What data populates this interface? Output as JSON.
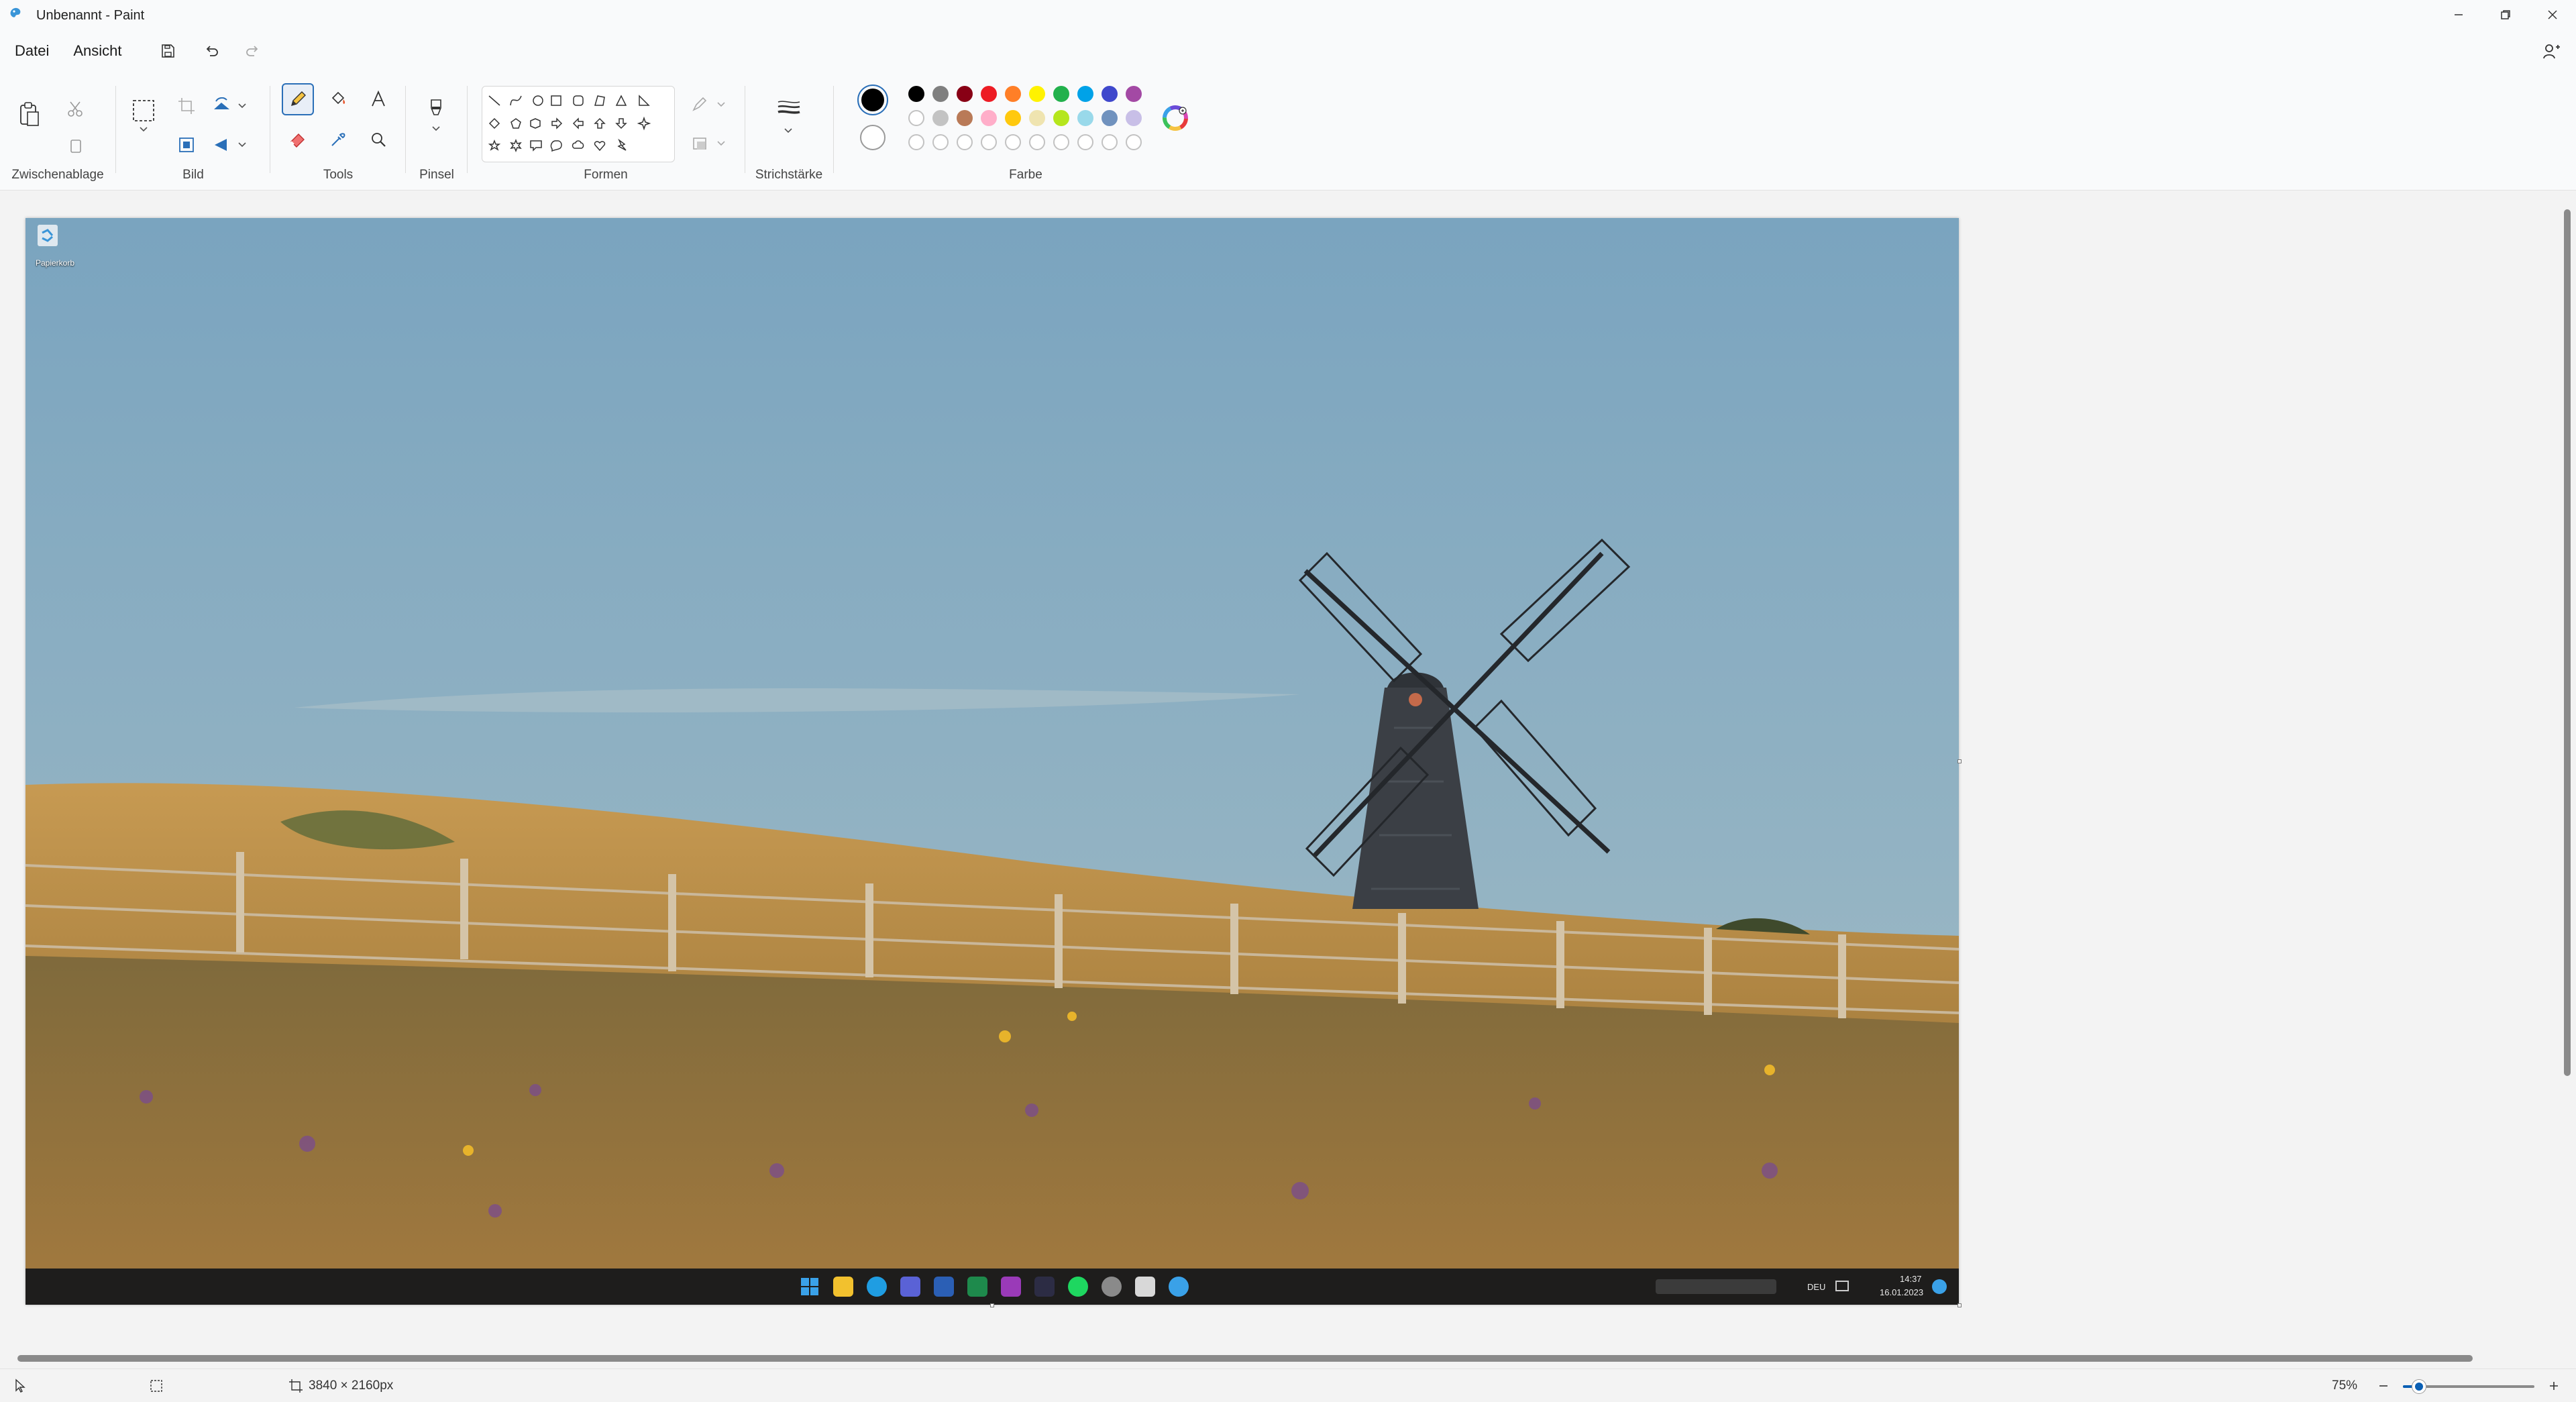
{
  "window": {
    "title": "Unbenannt - Paint"
  },
  "menu": {
    "file": "Datei",
    "view": "Ansicht"
  },
  "ribbon": {
    "clipboard": "Zwischenablage",
    "image": "Bild",
    "tools": "Tools",
    "brushes": "Pinsel",
    "shapes": "Formen",
    "stroke": "Strichstärke",
    "colors": "Farbe"
  },
  "palette": {
    "primary": "#000000",
    "secondary": "#ffffff",
    "row1": [
      "#000000",
      "#7f7f7f",
      "#880015",
      "#ed1c24",
      "#ff7f27",
      "#fff200",
      "#22b14c",
      "#00a2e8",
      "#3f48cc",
      "#a349a4"
    ],
    "row2": [
      "#ffffff",
      "#c3c3c3",
      "#b97a57",
      "#ffaec9",
      "#ffc90e",
      "#efe4b0",
      "#b5e61d",
      "#99d9ea",
      "#7092be",
      "#c8bfe7"
    ],
    "row3_empty_count": 10
  },
  "desktop": {
    "recycle_bin_label": "Papierkorb"
  },
  "taskbar": {
    "lang": "DEU",
    "time": "14:37",
    "date": "16.01.2023"
  },
  "status": {
    "dimensions": "3840 × 2160px",
    "zoom": "75%"
  },
  "zoom_slider": {
    "level": 0.12
  }
}
